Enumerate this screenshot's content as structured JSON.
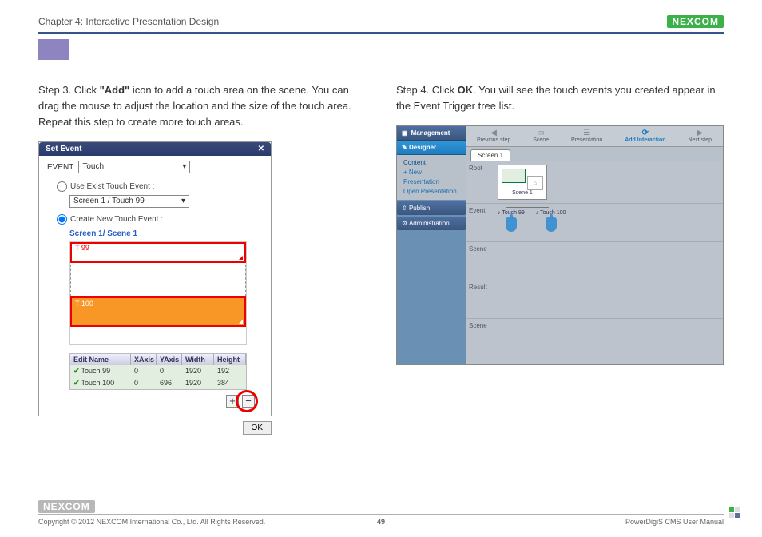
{
  "header": {
    "chapter": "Chapter 4: Interactive Presentation Design",
    "brand": "NEXCOM"
  },
  "left": {
    "step_html_a": "Step 3. Click ",
    "step_bold": "\"Add\"",
    "step_html_b": " icon to add a touch area on the scene. You can drag the mouse to adjust the location and the size of the touch area. Repeat this step to create more touch areas.",
    "panel": {
      "title": "Set Event",
      "event_label": "EVENT",
      "event_value": "Touch",
      "opt_existing": "Use Exist Touch Event :",
      "existing_value": "Screen 1 / Touch 99",
      "opt_create": "Create New Touch Event :",
      "scene_label": "Screen 1/ Scene 1",
      "t99": "T 99",
      "t100": "T 100",
      "table": {
        "headers": [
          "Edit Name",
          "XAxis",
          "YAxis",
          "Width",
          "Height"
        ],
        "rows": [
          [
            "Touch 99",
            "0",
            "0",
            "1920",
            "192"
          ],
          [
            "Touch 100",
            "0",
            "696",
            "1920",
            "384"
          ]
        ]
      },
      "ok": "OK"
    }
  },
  "right": {
    "step_a": "Step 4. Click ",
    "step_bold": "OK",
    "step_b": ". You will see the touch events you created appear in the Event Trigger tree list.",
    "sidebar": {
      "management": "Management",
      "designer": "Designer",
      "content": "Content",
      "newp": "+ New Presentation",
      "openp": "Open Presentation",
      "publish": "Publish",
      "admin": "Administration"
    },
    "toolbar": [
      "Previous step",
      "Scene",
      "Presentation",
      "Add Interaction",
      "Next step"
    ],
    "tab": "Screen 1",
    "rows": {
      "root": "Root",
      "event": "Event",
      "scene": "Scene",
      "result": "Result",
      "scene2": "Scene"
    },
    "card": "Scene 1",
    "ev1": "Touch 99",
    "ev2": "Touch 100"
  },
  "footer": {
    "copyright": "Copyright © 2012 NEXCOM International Co., Ltd. All Rights Reserved.",
    "page": "49",
    "manual": "PowerDigiS CMS User Manual"
  }
}
